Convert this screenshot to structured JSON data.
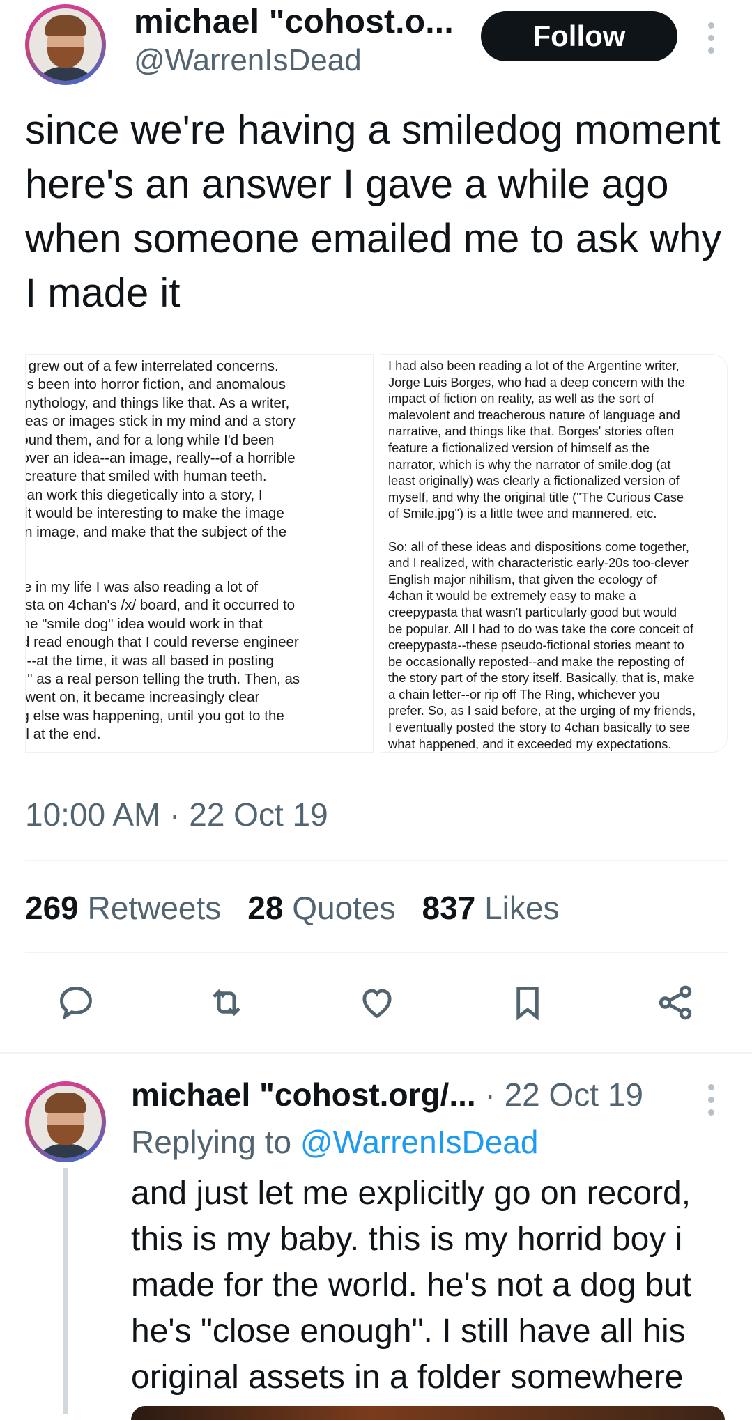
{
  "main_tweet": {
    "author_name": "michael \"cohost.o...",
    "author_handle": "@WarrenIsDead",
    "follow_label": "Follow",
    "text": "since we're having a smiledog moment here's an answer I gave a while ago when someone emailed me to ask why I made it",
    "images": {
      "left_text": ":ile.dog grew out of a few interrelated concerns.\ne always been into horror fiction, and anomalous\nlklore, mythology, and things like that. As a writer,\n:rtain ideas or images stick in my mind and a story\nows around them, and for a long while I'd been\norking over an idea--an image, really--of a horrible\nog-like creature that smiled with human teeth.\nather than work this diegetically into a story, I\necided it would be interesting to make the image\nerally an image, and make that the subject of the\nory.\n\nthis time in my life I was also reading a lot of\neepypasta on 4chan's /x/ board, and it occurred to\ne that the \"smile dog\" idea would work in that\nrmat. I'd read enough that I could reverse engineer\ne genre--at the time, it was all based in posting\normally,\" as a real person telling the truth. Then, as\ne story went on, it became increasingly clear\nmething else was happening, until you got to the\nn reveal at the end.",
      "right_text": "I had also been reading a lot of the Argentine writer,\nJorge Luis Borges, who had a deep concern with the\nimpact of fiction on reality, as well as the sort of\nmalevolent and treacherous nature of language and\nnarrative, and things like that. Borges' stories often\nfeature a fictionalized version of himself as the\nnarrator, which is why the narrator of smile.dog (at\nleast originally) was clearly a fictionalized version of\nmyself, and why the original title (\"The Curious Case\nof Smile.jpg\") is a little twee and mannered, etc.\n\nSo: all of these ideas and dispositions come together,\nand I realized, with characteristic early-20s too-clever\nEnglish major nihilism, that given the ecology of\n4chan it would be extremely easy to make a\ncreepypasta that wasn't particularly good but would\nbe popular. All I had to do was take the core conceit of\ncreepypasta--these pseudo-fictional stories meant to\nbe occasionally reposted--and make the reposting of\nthe story part of the story itself. Basically, that is, make\na chain letter--or rip off The Ring, whichever you\nprefer. So, as I said before, at the urging of my friends,\nI eventually posted the story to 4chan basically to see\nwhat happened, and it exceeded my expectations."
    },
    "timestamp": "10:00 AM · 22 Oct 19",
    "stats": {
      "retweets_count": "269",
      "retweets_label": "Retweets",
      "quotes_count": "28",
      "quotes_label": "Quotes",
      "likes_count": "837",
      "likes_label": "Likes"
    }
  },
  "actions": [
    "reply-icon",
    "retweet-icon",
    "like-icon",
    "bookmark-icon",
    "share-icon"
  ],
  "reply": {
    "author_name": "michael \"cohost.org/...",
    "date": " · 22 Oct 19",
    "replying_prefix": "Replying to ",
    "replying_mention": "@WarrenIsDead",
    "text": "and just let me explicitly go on record, this is my baby. this is my horrid boy i made for the world. he's not a dog but he's \"close enough\". I still have all his original assets in a folder somewhere"
  },
  "colors": {
    "text": "#0f1419",
    "secondary": "#536471",
    "link": "#1d9bf0",
    "button_bg": "#0f1419"
  }
}
